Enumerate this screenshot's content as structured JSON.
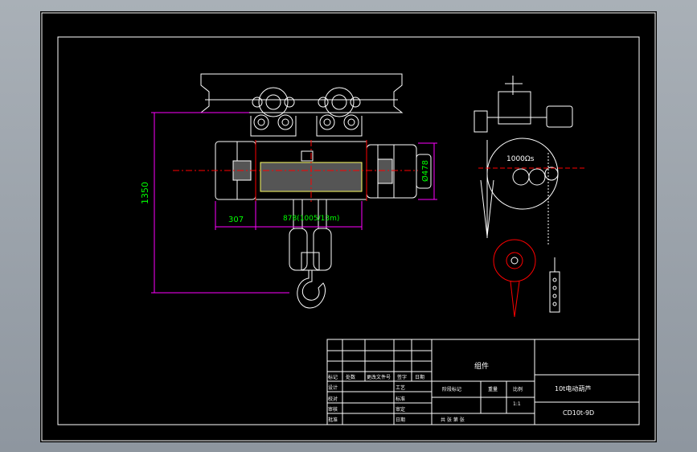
{
  "drawing": {
    "dimensions": {
      "height": "1350",
      "left_offset": "307",
      "span": "878(1005/13m)",
      "diameter": "Ø478"
    },
    "drum_label": "1000Ωs"
  },
  "title_block": {
    "assembly": "组件",
    "product_name": "10t电动葫芦",
    "drawing_number": "CD10t-9D",
    "scale_label": "比例",
    "scale_value": "1:1",
    "mass_label": "重量",
    "stage_label": "阶段标记",
    "sheet_info": "共 张  第 张",
    "header_cells": [
      "标记",
      "处数",
      "更改文件号",
      "签字",
      "日期"
    ],
    "row_labels_left": [
      "设计",
      "校对",
      "审核",
      "批准"
    ],
    "row_labels_mid": [
      "工艺",
      "标准",
      "审定",
      "日期"
    ]
  },
  "colors": {
    "white": "#ffffff",
    "magenta": "#ff00ff",
    "green": "#00ff00",
    "red": "#ff0000",
    "yellow": "#ffff66",
    "cyan": "#00ffff"
  }
}
